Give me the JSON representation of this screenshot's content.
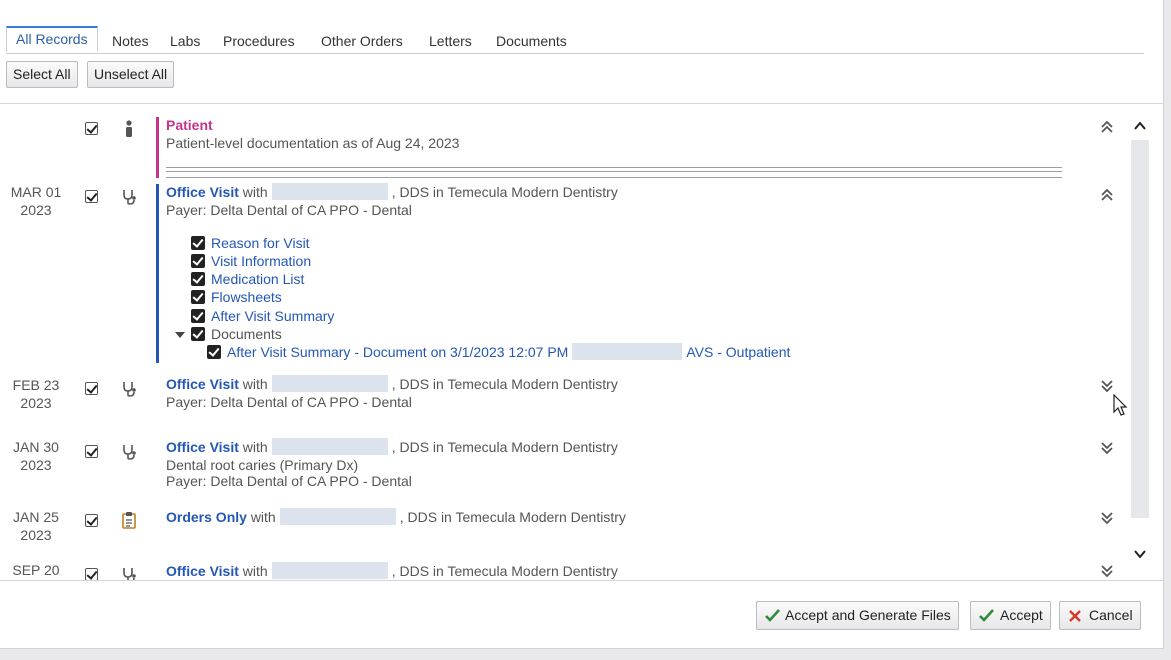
{
  "tabs": [
    "All Records",
    "Notes",
    "Labs",
    "Procedures",
    "Other Orders",
    "Letters",
    "Documents"
  ],
  "toolbar": {
    "select_all": "Select All",
    "unselect_all": "Unselect All"
  },
  "records": {
    "patient": {
      "title": "Patient",
      "subtitle": "Patient-level documentation as of Aug 24, 2023",
      "accent": "#c4348f"
    },
    "r1": {
      "date_mon": "MAR 01",
      "date_year": "2023",
      "type": "Office Visit",
      "with": "with",
      "provider_suffix": ", DDS in Temecula Modern Dentistry",
      "payer": "Payer: Delta Dental of CA PPO - Dental",
      "accent": "#2457b5",
      "items": [
        "Reason for Visit",
        "Visit Information",
        "Medication List",
        "Flowsheets",
        "After Visit Summary",
        "Documents"
      ],
      "doc_link": "After Visit Summary - Document on 3/1/2023 12:07 PM",
      "doc_suffix": "AVS - Outpatient"
    },
    "r2": {
      "date_mon": "FEB 23",
      "date_year": "2023",
      "type": "Office Visit",
      "with": "with",
      "provider_suffix": ", DDS in Temecula Modern Dentistry",
      "payer": "Payer: Delta Dental of CA PPO - Dental"
    },
    "r3": {
      "date_mon": "JAN 30",
      "date_year": "2023",
      "type": "Office Visit",
      "with": "with",
      "provider_suffix": ", DDS in Temecula Modern Dentistry",
      "dx": "Dental root caries (Primary Dx)",
      "payer": "Payer: Delta Dental of CA PPO - Dental"
    },
    "r4": {
      "date_mon": "JAN 25",
      "date_year": "2023",
      "type": "Orders Only",
      "with": "with",
      "provider_suffix": ", DDS in Temecula Modern Dentistry"
    },
    "r5": {
      "date_mon": "SEP 20",
      "type": "Office Visit",
      "with": "with",
      "provider_suffix": ", DDS in Temecula Modern Dentistry"
    }
  },
  "footer": {
    "accept_generate": "Accept and Generate Files",
    "accept": "Accept",
    "cancel": "Cancel"
  },
  "colors": {
    "link": "#2457b5",
    "patient": "#c4348f",
    "accept_check": "#2e8b3d",
    "cancel_x": "#d23a2a"
  }
}
